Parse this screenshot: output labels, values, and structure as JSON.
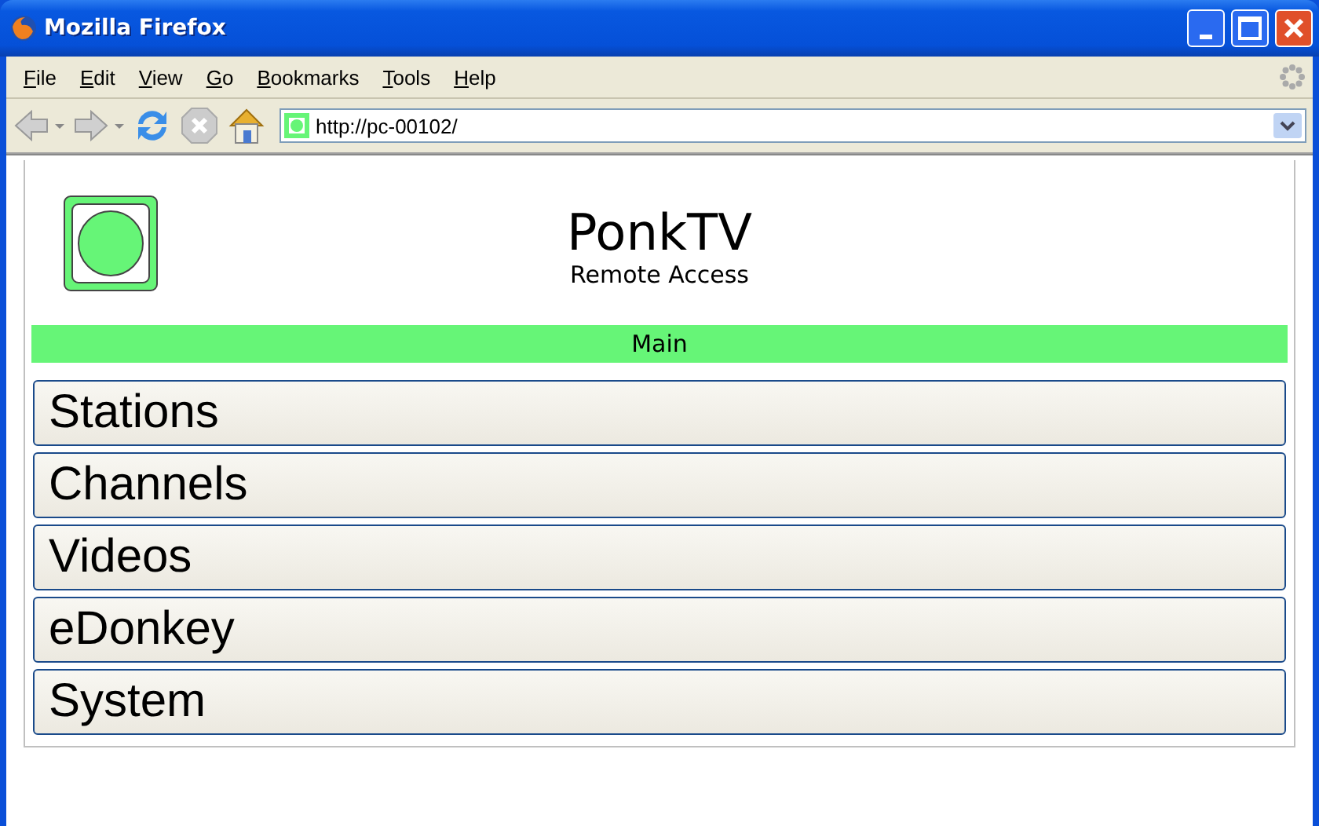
{
  "window": {
    "title": "Mozilla Firefox"
  },
  "menu": [
    {
      "accel": "F",
      "rest": "ile"
    },
    {
      "accel": "E",
      "rest": "dit"
    },
    {
      "accel": "V",
      "rest": "iew"
    },
    {
      "accel": "G",
      "rest": "o"
    },
    {
      "accel": "B",
      "rest": "ookmarks"
    },
    {
      "accel": "T",
      "rest": "ools"
    },
    {
      "accel": "H",
      "rest": "elp"
    }
  ],
  "address": {
    "value": "http://pc-00102/"
  },
  "page": {
    "title": "PonkTV",
    "subtitle": "Remote Access",
    "section": "Main",
    "items": [
      "Stations",
      "Channels",
      "Videos",
      "eDonkey",
      "System"
    ]
  }
}
